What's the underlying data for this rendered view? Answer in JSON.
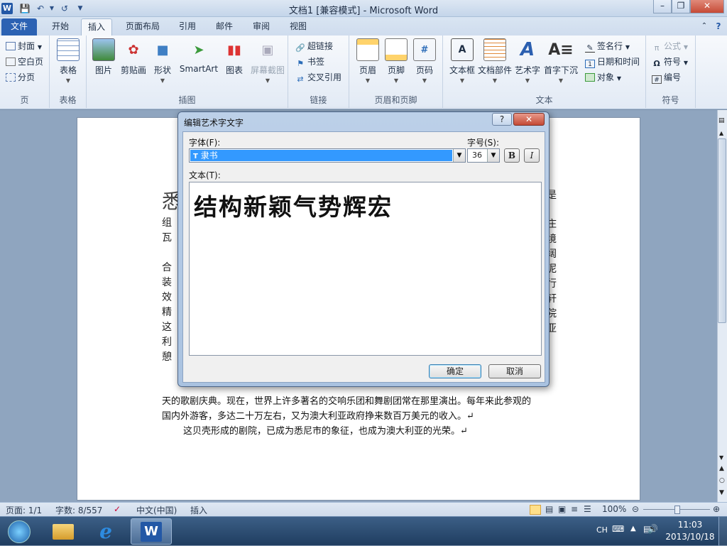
{
  "window": {
    "title": "文档1 [兼容模式] - Microsoft Word"
  },
  "colors": {
    "accent": "#2c62b3",
    "selection": "#3399ff"
  },
  "tabs": {
    "file": "文件",
    "items": [
      "开始",
      "插入",
      "页面布局",
      "引用",
      "邮件",
      "审阅",
      "视图"
    ],
    "active": "插入"
  },
  "ribbon": {
    "pages": {
      "label": "页",
      "cover": "封面",
      "blank": "空白页",
      "break": "分页"
    },
    "table": {
      "label": "表格",
      "table": "表格"
    },
    "illus": {
      "label": "插图",
      "picture": "图片",
      "clipart": "剪贴画",
      "shapes": "形状",
      "smartart": "SmartArt",
      "chart": "图表",
      "screenshot": "屏幕截图"
    },
    "links": {
      "label": "链接",
      "hyperlink": "超链接",
      "bookmark": "书签",
      "crossref": "交叉引用"
    },
    "hf": {
      "label": "页眉和页脚",
      "header": "页眉",
      "footer": "页脚",
      "pagenum": "页码"
    },
    "text": {
      "label": "文本",
      "textbox": "文本框",
      "parts": "文档部件",
      "wordart": "艺术字",
      "dropcap": "首字下沉",
      "signature": "签名行",
      "datetime": "日期和时间",
      "object": "对象"
    },
    "symbols": {
      "label": "符号",
      "equation": "公式",
      "symbol": "符号",
      "number": "编号"
    }
  },
  "document": {
    "heading_char": "悉",
    "left_chars": [
      "组",
      "瓦",
      "合",
      "装",
      "效",
      "精",
      "这",
      "利",
      "憩"
    ],
    "right_chars": [
      "是",
      "庄",
      "境",
      "阔",
      "泥",
      "行",
      "轩",
      "院",
      "亚"
    ],
    "lines": [
      "天的歌剧庆典。现在，世界上许多著名的交响乐团和舞剧团常在那里演出。每年来此参观的",
      "国内外游客，多达二十万左右，又为澳大利亚政府挣来数百万美元的收入。↵",
      "这贝壳形成的剧院，已成为悉尼市的象征，也成为澳大利亚的光荣。↵"
    ]
  },
  "dialog": {
    "title": "编辑艺术字文字",
    "font_label": "字体(F):",
    "font_value": "隶书",
    "size_label": "字号(S):",
    "size_value": "36",
    "bold": "B",
    "italic": "I",
    "text_label": "文本(T):",
    "text_value": "结构新颖气势辉宏",
    "ok": "确定",
    "cancel": "取消",
    "help": "?",
    "close": "✕"
  },
  "statusbar": {
    "page": "页面: 1/1",
    "words": "字数: 8/557",
    "lang": "中文(中国)",
    "mode": "插入",
    "zoom": "100%"
  },
  "taskbar": {
    "ime": "CH",
    "time": "11:03",
    "date": "2013/10/18"
  }
}
